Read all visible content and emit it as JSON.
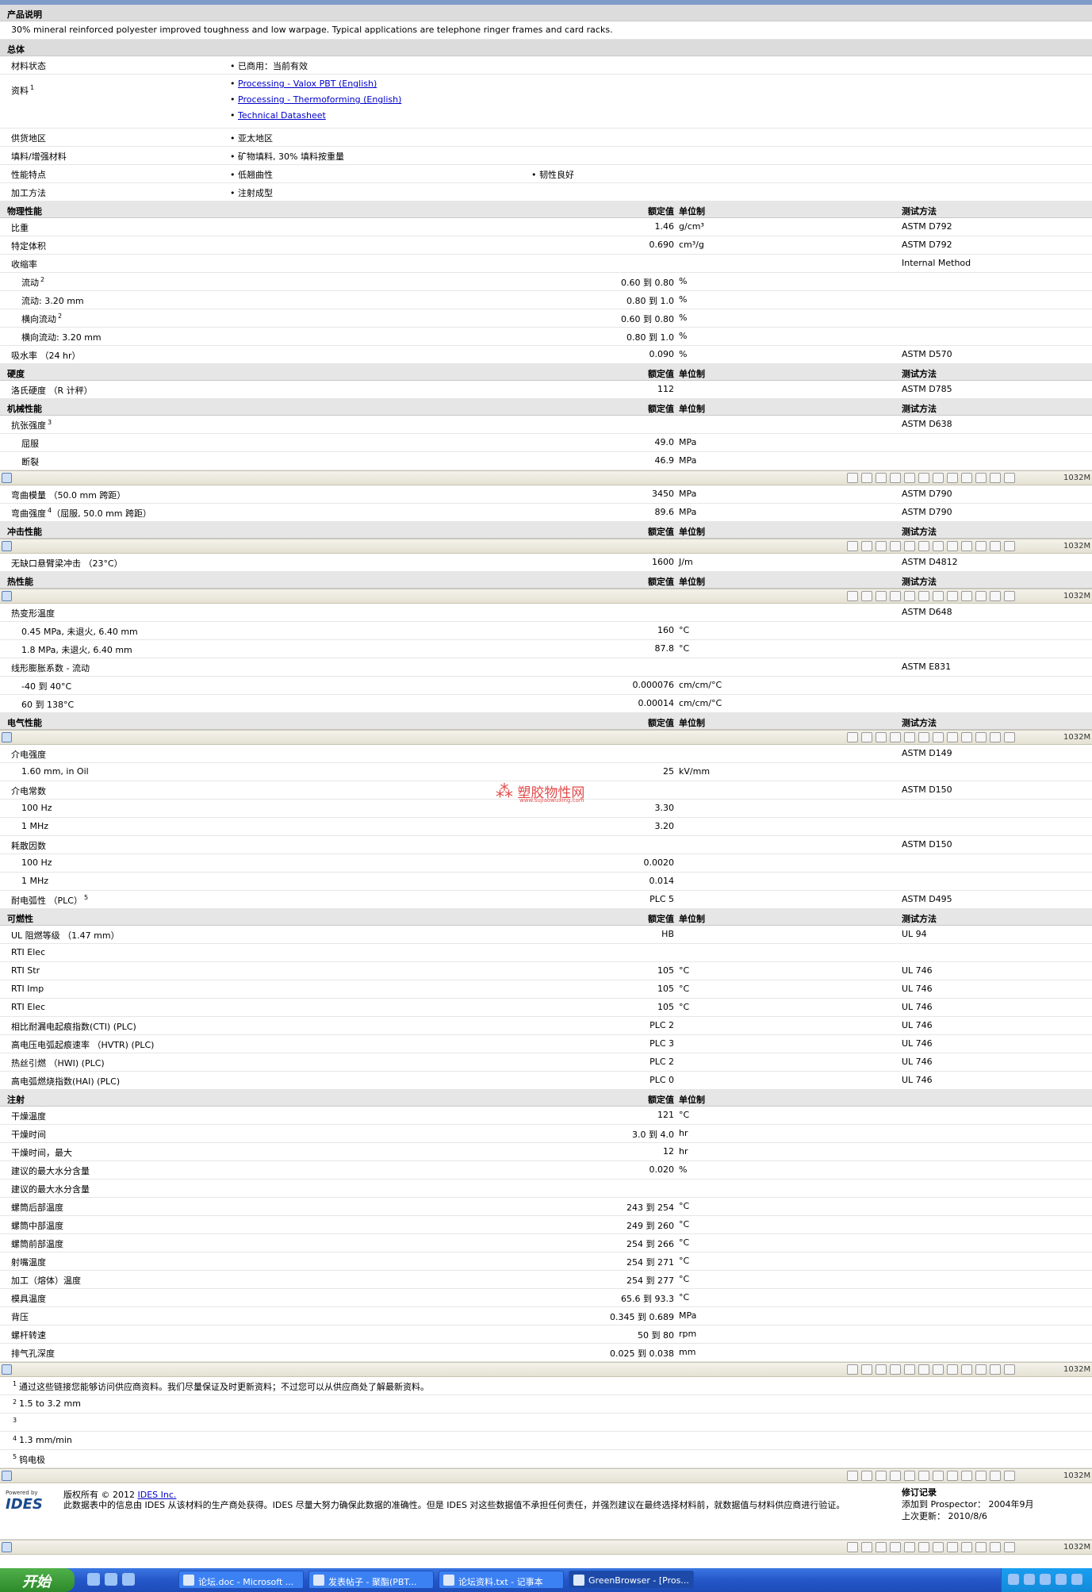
{
  "product_description": {
    "title": "产品说明",
    "text": "30% mineral reinforced polyester improved toughness and low warpage. Typical applications are telephone ringer frames and card racks."
  },
  "general": {
    "title": "总体",
    "material_status_label": "材料状态",
    "material_status_value": "已商用：当前有效",
    "docs_label": "资料",
    "docs_sup": "1",
    "docs": [
      "Processing - Valox PBT (English)",
      "Processing - Thermoforming (English)",
      "Technical Datasheet"
    ],
    "region_label": "供货地区",
    "region_value": "亚太地区",
    "filler_label": "填料/增强材料",
    "filler_value": "矿物填料, 30% 填料按重量",
    "features_label": "性能特点",
    "features_values": [
      "低翘曲性",
      "韧性良好"
    ],
    "process_label": "加工方法",
    "process_value": "注射成型"
  },
  "headers": {
    "nominal": "额定值",
    "unit": "单位制",
    "test": "测试方法"
  },
  "physical": {
    "title": "物理性能",
    "rows": [
      {
        "label": "比重",
        "value": "1.46",
        "unit": "g/cm³",
        "test": "ASTM D792"
      },
      {
        "label": "特定体积",
        "value": "0.690",
        "unit": "cm³/g",
        "test": "ASTM D792"
      },
      {
        "label": "收缩率",
        "value": "",
        "unit": "",
        "test": "Internal Method"
      },
      {
        "label": "流动",
        "sup": "2",
        "sub": true,
        "value": "0.60 到  0.80",
        "unit": "%",
        "test": ""
      },
      {
        "label": "流动: 3.20 mm",
        "sub": true,
        "value": "0.80 到  1.0",
        "unit": "%",
        "test": ""
      },
      {
        "label": "横向流动",
        "sup": "2",
        "sub": true,
        "value": "0.60 到  0.80",
        "unit": "%",
        "test": ""
      },
      {
        "label": "横向流动: 3.20 mm",
        "sub": true,
        "value": "0.80 到  1.0",
        "unit": "%",
        "test": ""
      },
      {
        "label": "吸水率 （24 hr）",
        "value": "0.090",
        "unit": "%",
        "test": "ASTM D570"
      }
    ]
  },
  "hardness": {
    "title": "硬度",
    "rows": [
      {
        "label": "洛氏硬度 （R 计秤）",
        "value": "112",
        "unit": "",
        "test": "ASTM D785"
      }
    ]
  },
  "mechanical": {
    "title": "机械性能",
    "rows": [
      {
        "label": "抗张强度",
        "sup": "3",
        "value": "",
        "unit": "",
        "test": "ASTM D638"
      },
      {
        "label": "屈服",
        "sub": true,
        "value": "49.0",
        "unit": "MPa",
        "test": ""
      },
      {
        "label": "断裂",
        "sub": true,
        "value": "46.9",
        "unit": "MPa",
        "test": ""
      }
    ]
  },
  "mechanical2": {
    "rows": [
      {
        "label": "弯曲模量 （50.0 mm 跨距）",
        "value": "3450",
        "unit": "MPa",
        "test": "ASTM D790"
      },
      {
        "label": "弯曲强度",
        "sup": "4",
        "label2": "（屈服, 50.0 mm 跨距）",
        "value": "89.6",
        "unit": "MPa",
        "test": "ASTM D790"
      }
    ]
  },
  "impact": {
    "title": "冲击性能",
    "rows": [
      {
        "label": "无缺口悬臂梁冲击 （23°C）",
        "value": "1600",
        "unit": "J/m",
        "test": "ASTM D4812"
      }
    ]
  },
  "thermal": {
    "title": "热性能",
    "rows": [
      {
        "label": "热变形温度",
        "value": "",
        "unit": "",
        "test": "ASTM D648"
      },
      {
        "label": "0.45 MPa, 未退火, 6.40 mm",
        "sub": true,
        "value": "160",
        "unit": "°C",
        "test": ""
      },
      {
        "label": "1.8 MPa, 未退火, 6.40 mm",
        "sub": true,
        "value": "87.8",
        "unit": "°C",
        "test": ""
      },
      {
        "label": "线形膨胀系数 - 流动",
        "value": "",
        "unit": "",
        "test": "ASTM E831"
      },
      {
        "label": "-40 到  40°C",
        "sub": true,
        "value": "0.000076",
        "unit": "cm/cm/°C",
        "test": ""
      },
      {
        "label": "60 到  138°C",
        "sub": true,
        "value": "0.00014",
        "unit": "cm/cm/°C",
        "test": ""
      }
    ]
  },
  "electrical": {
    "title": "电气性能",
    "rows": [
      {
        "label": "介电强度",
        "value": "",
        "unit": "",
        "test": "ASTM D149"
      },
      {
        "label": "1.60 mm, in Oil",
        "sub": true,
        "value": "25",
        "unit": "kV/mm",
        "test": ""
      },
      {
        "label": "介电常数",
        "value": "",
        "unit": "",
        "test": "ASTM D150"
      },
      {
        "label": "100 Hz",
        "sub": true,
        "value": "3.30",
        "unit": "",
        "test": ""
      },
      {
        "label": "1 MHz",
        "sub": true,
        "value": "3.20",
        "unit": "",
        "test": ""
      },
      {
        "label": "耗散因数",
        "value": "",
        "unit": "",
        "test": "ASTM D150"
      },
      {
        "label": "100 Hz",
        "sub": true,
        "value": "0.0020",
        "unit": "",
        "test": ""
      },
      {
        "label": "1 MHz",
        "sub": true,
        "value": "0.014",
        "unit": "",
        "test": ""
      },
      {
        "label": "耐电弧性 （PLC）",
        "sup": "5",
        "value": "PLC 5",
        "unit": "",
        "test": "ASTM D495"
      }
    ]
  },
  "flammability": {
    "title": "可燃性",
    "rows": [
      {
        "label": "UL 阻燃等级 （1.47 mm）",
        "value": "HB",
        "unit": "",
        "test": "UL 94"
      },
      {
        "label": "RTI Elec",
        "value": "",
        "unit": "",
        "test": ""
      },
      {
        "label": "RTI Str",
        "value": "105",
        "unit": "°C",
        "test": "UL 746"
      },
      {
        "label": "RTI Imp",
        "value": "105",
        "unit": "°C",
        "test": "UL 746"
      },
      {
        "label": "RTI Elec",
        "value": "105",
        "unit": "°C",
        "test": "UL 746"
      },
      {
        "label": "相比耐漏电起痕指数(CTI) (PLC)",
        "value": "PLC 2",
        "unit": "",
        "test": "UL 746"
      },
      {
        "label": "高电压电弧起痕速率 （HVTR) (PLC)",
        "value": "PLC 3",
        "unit": "",
        "test": "UL 746"
      },
      {
        "label": "热丝引燃 （HWI) (PLC)",
        "value": "PLC 2",
        "unit": "",
        "test": "UL 746"
      },
      {
        "label": "高电弧燃烧指数(HAI) (PLC)",
        "value": "PLC 0",
        "unit": "",
        "test": "UL 746"
      }
    ]
  },
  "injection": {
    "title": "注射",
    "rows": [
      {
        "label": "干燥温度",
        "value": "121",
        "unit": "°C",
        "test": ""
      },
      {
        "label": "干燥时间",
        "value": "3.0 到  4.0",
        "unit": "hr",
        "test": ""
      },
      {
        "label": "干燥时间，最大",
        "value": "12",
        "unit": "hr",
        "test": ""
      },
      {
        "label": "建议的最大水分含量",
        "value": "0.020",
        "unit": "%",
        "test": ""
      },
      {
        "label": "建议的最大水分含量",
        "value": "",
        "unit": "",
        "test": ""
      },
      {
        "label": "螺筒后部温度",
        "value": "243 到  254",
        "unit": "°C",
        "test": ""
      },
      {
        "label": "螺筒中部温度",
        "value": "249 到  260",
        "unit": "°C",
        "test": ""
      },
      {
        "label": "螺筒前部温度",
        "value": "254 到  266",
        "unit": "°C",
        "test": ""
      },
      {
        "label": "射嘴温度",
        "value": "254 到  271",
        "unit": "°C",
        "test": ""
      },
      {
        "label": "加工（熔体）温度",
        "value": "254 到  277",
        "unit": "°C",
        "test": ""
      },
      {
        "label": "模具温度",
        "value": "65.6 到  93.3",
        "unit": "°C",
        "test": ""
      },
      {
        "label": "背压",
        "value": "0.345 到  0.689",
        "unit": "MPa",
        "test": ""
      },
      {
        "label": "螺杆转速",
        "value": "50 到  80",
        "unit": "rpm",
        "test": ""
      },
      {
        "label": "排气孔深度",
        "value": "0.025 到  0.038",
        "unit": "mm",
        "test": ""
      }
    ]
  },
  "notes": [
    {
      "n": "1",
      "text": "通过这些链接您能够访问供应商资料。我们尽量保证及时更新资料；不过您可以从供应商处了解最新资料。"
    },
    {
      "n": "2",
      "text": "1.5 to 3.2 mm"
    },
    {
      "n": "3",
      "text": ""
    },
    {
      "n": "4",
      "text": "1.3 mm/min"
    },
    {
      "n": "5",
      "text": "钨电极"
    }
  ],
  "footer": {
    "copyright": "版权所有 © 2012",
    "company": "IDES Inc.",
    "disclaimer": "此数据表中的信息由 IDES 从该材料的生产商处获得。IDES 尽量大努力确保此数据的准确性。但是 IDES 对这些数据值不承担任何责任，并强烈建议在最终选择材料前，就数据值与材料供应商进行验证。",
    "rev_title": "修订记录",
    "rev_added_label": "添加到 Prospector：",
    "rev_added": "2004年9月",
    "rev_updated_label": "上次更新：",
    "rev_updated": "2010/8/6",
    "powered": "Powered by",
    "logo": "IDES"
  },
  "watermark": {
    "name": "塑胶物性网",
    "url": "www.sujiaowuxing.com"
  },
  "browser_toolbar": {
    "zoom_text": "1032M"
  },
  "taskbar": {
    "start": "开始",
    "tasks": [
      "论坛.doc - Microsoft ...",
      "发表帖子 - 聚酯(PBT...",
      "论坛资料.txt - 记事本",
      "GreenBrowser - [Pros..."
    ]
  },
  "colors": {
    "section_bg": "#dcdcdc",
    "link": "#0000cc",
    "taskbar": "#2456c9",
    "watermark": "#e24b4b"
  }
}
